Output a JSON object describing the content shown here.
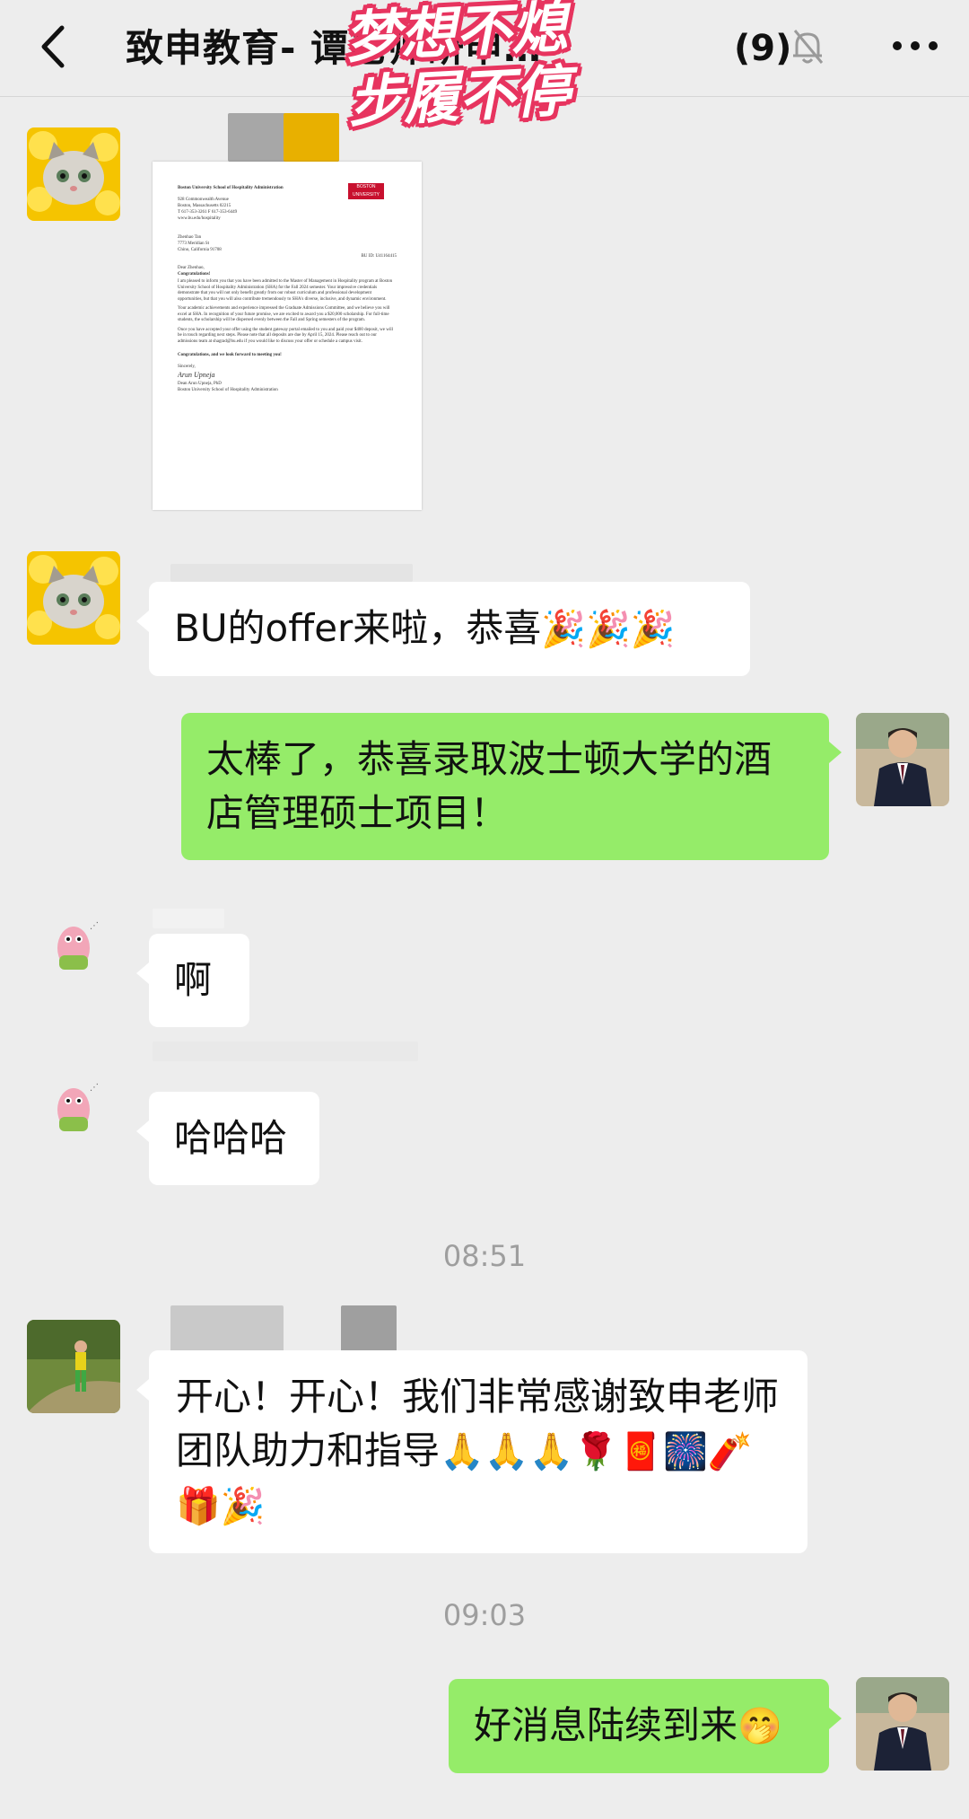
{
  "header": {
    "title": "致申教育- 谭老师研申…",
    "count": "(9)",
    "sticker_line1": "梦想不熄",
    "sticker_line2": "步履不停"
  },
  "letter": {
    "org": "Boston University School of Hospitality Administration",
    "logo": "BOSTON UNIVERSITY",
    "address": [
      "928 Commonwealth Avenue",
      "Boston, Massachusetts 02215",
      "T 617-353-3261  F 617-353-6449",
      "www.bu.edu/hospitality"
    ],
    "recipient": [
      "Zhenhao Tan",
      "7773 Meridian St",
      "Chino, California 91708"
    ],
    "bu_id": "BU ID: U41164415",
    "greeting": "Dear Zhenhao,",
    "congrats": "Congratulations!",
    "para1": "I am pleased to inform you that you have been admitted to the Master of Management in Hospitality program at Boston University School of Hospitality Administration (SHA) for the Fall 2024 semester. Your impressive credentials demonstrate that you will not only benefit greatly from our robust curriculum and professional development opportunities, but that you will also contribute tremendously to SHA's diverse, inclusive, and dynamic environment.",
    "para2": "Your academic achievements and experience impressed the Graduate Admissions Committee, and we believe you will excel at SHA. In recognition of your future promise, we are excited to award you a $20,000 scholarship. For full-time students, the scholarship will be dispersed evenly between the Fall and Spring semesters of the program.",
    "para3": "Once you have accepted your offer using the student gateway portal emailed to you and paid your $400 deposit, we will be in touch regarding next steps. Please note that all deposits are due by April 15, 2024. Please reach out to our admissions team at shagrad@bu.edu if you would like to discuss your offer or schedule a campus visit.",
    "closing": "Congratulations, and we look forward to meeting you!",
    "sincerely": "Sincerely,",
    "signature": "Arun Upneja",
    "signer": "Dean Arun Upneja, PhD",
    "signer_org": "Boston University School of Hospitality Administration"
  },
  "messages": [
    {
      "text": "BU的offer来啦，恭喜",
      "emoji": "🎉🎉🎉"
    },
    {
      "text": "太棒了，恭喜录取波士顿大学的酒店管理硕士项目！"
    },
    {
      "text": "啊"
    },
    {
      "text": "哈哈哈"
    },
    {
      "text": "开心！开心！我们非常感谢致申老师团队助力和指导",
      "emoji": "🙏🙏🙏🌹🧧🎆🧨🎁🎉"
    },
    {
      "text": "好消息陆续到来",
      "emoji": "🤭"
    }
  ],
  "timestamps": [
    "08:51",
    "09:03"
  ],
  "icons": {
    "back": "chevron-left-icon",
    "mute": "bell-off-icon",
    "more": "more-dots-icon"
  },
  "colors": {
    "background": "#ededed",
    "sent_bubble": "#95ec69",
    "received_bubble": "#ffffff",
    "sticker": "#e7345f"
  }
}
